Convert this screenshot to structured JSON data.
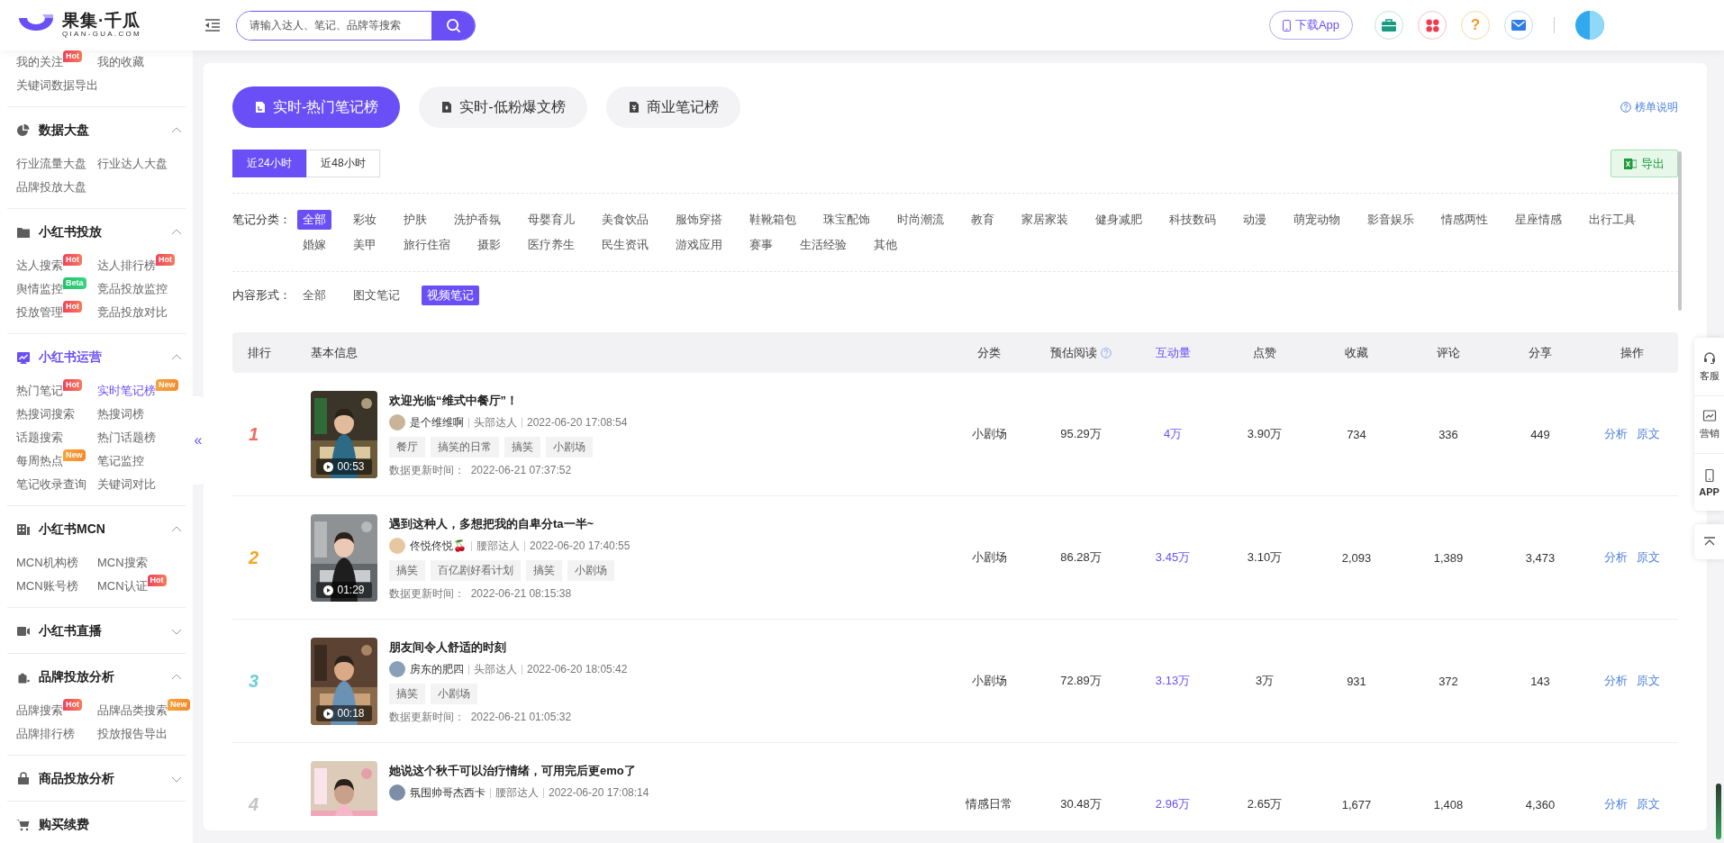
{
  "logo": {
    "title": "果集·千瓜",
    "subtitle": "QIAN-GUA.COM"
  },
  "top_bar": {
    "search": {
      "placeholder": "请输入达人、笔记、品牌等搜索"
    },
    "download_button": "下载App",
    "help_button": "?"
  },
  "sidebar": {
    "sections": [
      {
        "items": [
          {
            "label": "我的关注",
            "selected": false,
            "badge": {
              "kind": "hot",
              "label": "Hot"
            }
          },
          {
            "label": "我的收藏",
            "selected": false
          },
          {
            "label": "关键词数据导出",
            "selected": false
          }
        ]
      },
      {
        "kind": "group",
        "title": "数据大盘",
        "active": false,
        "expanded": true,
        "items": [
          {
            "label": "行业流量大盘",
            "selected": false
          },
          {
            "label": "行业达人大盘",
            "selected": false
          },
          {
            "label": "品牌投放大盘",
            "selected": false
          }
        ]
      },
      {
        "kind": "group",
        "title": "小红书投放",
        "active": false,
        "expanded": true,
        "items": [
          {
            "label": "达人搜索",
            "selected": false,
            "badge": {
              "kind": "hot",
              "label": "Hot"
            }
          },
          {
            "label": "达人排行榜",
            "selected": false,
            "badge": {
              "kind": "hot",
              "label": "Hot"
            }
          },
          {
            "label": "舆情监控",
            "selected": false,
            "badge": {
              "kind": "beta",
              "label": "Beta"
            }
          },
          {
            "label": "竞品投放监控",
            "selected": false
          },
          {
            "label": "投放管理",
            "selected": false,
            "badge": {
              "kind": "hot",
              "label": "Hot"
            }
          },
          {
            "label": "竞品投放对比",
            "selected": false
          }
        ]
      },
      {
        "kind": "group",
        "title": "小红书运营",
        "active": true,
        "expanded": true,
        "items": [
          {
            "label": "热门笔记",
            "selected": false,
            "badge": {
              "kind": "hot",
              "label": "Hot"
            }
          },
          {
            "label": "实时笔记榜",
            "selected": true,
            "badge": {
              "kind": "new",
              "label": "New"
            }
          },
          {
            "label": "热搜词搜索",
            "selected": false
          },
          {
            "label": "热搜词榜",
            "selected": false
          },
          {
            "label": "话题搜索",
            "selected": false
          },
          {
            "label": "热门话题榜",
            "selected": false
          },
          {
            "label": "每周热点",
            "selected": false,
            "badge": {
              "kind": "new",
              "label": "New"
            }
          },
          {
            "label": "笔记监控",
            "selected": false
          },
          {
            "label": "笔记收录查询",
            "selected": false
          },
          {
            "label": "关键词对比",
            "selected": false
          }
        ]
      },
      {
        "kind": "group",
        "title": "小红书MCN",
        "active": false,
        "expanded": true,
        "items": [
          {
            "label": "MCN机构榜",
            "selected": false
          },
          {
            "label": "MCN搜索",
            "selected": false
          },
          {
            "label": "MCN账号榜",
            "selected": false
          },
          {
            "label": "MCN认证",
            "selected": false,
            "badge": {
              "kind": "hot",
              "label": "Hot"
            }
          }
        ]
      },
      {
        "kind": "group",
        "title": "小红书直播",
        "active": false,
        "expanded": false
      },
      {
        "kind": "group",
        "title": "品牌投放分析",
        "active": false,
        "expanded": true,
        "items": [
          {
            "label": "品牌搜索",
            "selected": false,
            "badge": {
              "kind": "hot",
              "label": "Hot"
            }
          },
          {
            "label": "品牌品类搜索",
            "selected": false,
            "badge": {
              "kind": "new",
              "label": "New"
            }
          },
          {
            "label": "品牌排行榜",
            "selected": false
          },
          {
            "label": "投放报告导出",
            "selected": false
          }
        ]
      },
      {
        "kind": "group",
        "title": "商品投放分析",
        "active": false,
        "expanded": false
      },
      {
        "kind": "link",
        "title": "购买续费",
        "active": false
      }
    ],
    "collapse_handle": "«"
  },
  "tabs": [
    {
      "label": "实时-热门笔记榜",
      "selected": true
    },
    {
      "label": "实时-低粉爆文榜",
      "selected": false
    },
    {
      "label": "商业笔记榜",
      "selected": false
    }
  ],
  "help_link": "榜单说明",
  "time_ranges": [
    {
      "label": "近24小时",
      "selected": true
    },
    {
      "label": "近48小时",
      "selected": false
    }
  ],
  "export_button": "导出",
  "category_filter": {
    "label": "笔记分类：",
    "options": [
      {
        "label": "全部",
        "selected": true
      },
      {
        "label": "彩妆",
        "selected": false
      },
      {
        "label": "护肤",
        "selected": false
      },
      {
        "label": "洗护香氛",
        "selected": false
      },
      {
        "label": "母婴育儿",
        "selected": false
      },
      {
        "label": "美食饮品",
        "selected": false
      },
      {
        "label": "服饰穿搭",
        "selected": false
      },
      {
        "label": "鞋靴箱包",
        "selected": false
      },
      {
        "label": "珠宝配饰",
        "selected": false
      },
      {
        "label": "时尚潮流",
        "selected": false
      },
      {
        "label": "教育",
        "selected": false
      },
      {
        "label": "家居家装",
        "selected": false
      },
      {
        "label": "健身减肥",
        "selected": false
      },
      {
        "label": "科技数码",
        "selected": false
      },
      {
        "label": "动漫",
        "selected": false
      },
      {
        "label": "萌宠动物",
        "selected": false
      },
      {
        "label": "影音娱乐",
        "selected": false
      },
      {
        "label": "情感两性",
        "selected": false
      },
      {
        "label": "星座情感",
        "selected": false
      },
      {
        "label": "出行工具",
        "selected": false
      },
      {
        "label": "婚嫁",
        "selected": false
      },
      {
        "label": "美甲",
        "selected": false
      },
      {
        "label": "旅行住宿",
        "selected": false
      },
      {
        "label": "摄影",
        "selected": false
      },
      {
        "label": "医疗养生",
        "selected": false
      },
      {
        "label": "民生资讯",
        "selected": false
      },
      {
        "label": "游戏应用",
        "selected": false
      },
      {
        "label": "赛事",
        "selected": false
      },
      {
        "label": "生活经验",
        "selected": false
      },
      {
        "label": "其他",
        "selected": false
      }
    ]
  },
  "format_filter": {
    "label": "内容形式：",
    "options": [
      {
        "label": "全部",
        "selected": false
      },
      {
        "label": "图文笔记",
        "selected": false
      },
      {
        "label": "视频笔记",
        "selected": true
      }
    ]
  },
  "table": {
    "columns": [
      {
        "label": "排行",
        "sorted": false,
        "help": false
      },
      {
        "label": "基本信息",
        "sorted": false,
        "help": false
      },
      {
        "label": "分类",
        "sorted": false,
        "help": false
      },
      {
        "label": "预估阅读",
        "sorted": false,
        "help": true
      },
      {
        "label": "互动量",
        "sorted": true,
        "help": false
      },
      {
        "label": "点赞",
        "sorted": false,
        "help": false
      },
      {
        "label": "收藏",
        "sorted": false,
        "help": false
      },
      {
        "label": "评论",
        "sorted": false,
        "help": false
      },
      {
        "label": "分享",
        "sorted": false,
        "help": false
      },
      {
        "label": "操作",
        "sorted": false,
        "help": false
      }
    ],
    "rows": [
      {
        "rank": "1",
        "color": "#ef6a5b",
        "duration": "00:53",
        "title": "欢迎光临“维式中餐厅”！",
        "author": "是个维维啊",
        "tier": "头部达人",
        "published": "2022-06-20 17:08:54",
        "tags": [
          "餐厅",
          "搞笑的日常",
          "搞笑",
          "小剧场"
        ],
        "updated_label": "数据更新时间：",
        "updated": "2022-06-21 07:37:52",
        "stats": [
          "小剧场",
          "95.29万",
          "4万",
          "3.90万",
          "734",
          "336",
          "449"
        ],
        "actions": [
          "分析",
          "原文"
        ]
      },
      {
        "rank": "2",
        "color": "#f5a623",
        "duration": "01:29",
        "title": "遇到这种人，多想把我的自卑分ta一半~",
        "author": "佟悦佟悦🍒",
        "tier": "腰部达人",
        "published": "2022-06-20 17:40:55",
        "tags": [
          "搞笑",
          "百亿剧好看计划",
          "搞笑",
          "小剧场"
        ],
        "updated_label": "数据更新时间：",
        "updated": "2022-06-21 08:15:38",
        "stats": [
          "小剧场",
          "86.28万",
          "3.45万",
          "3.10万",
          "2,093",
          "1,389",
          "3,473"
        ],
        "actions": [
          "分析",
          "原文"
        ]
      },
      {
        "rank": "3",
        "color": "#71cfd8",
        "duration": "00:18",
        "title": "朋友间令人舒适的时刻",
        "author": "房东的肥四",
        "tier": "头部达人",
        "published": "2022-06-20 18:05:42",
        "tags": [
          "搞笑",
          "小剧场"
        ],
        "updated_label": "数据更新时间：",
        "updated": "2022-06-21 01:05:32",
        "stats": [
          "小剧场",
          "72.89万",
          "3.13万",
          "3万",
          "931",
          "372",
          "143"
        ],
        "actions": [
          "分析",
          "原文"
        ]
      },
      {
        "rank": "4",
        "color": "#c4c4c4",
        "title": "她说这个秋千可以治疗情绪，可用完后更emo了",
        "author": "氛围帅哥杰西卡",
        "tier": "腰部达人",
        "published": "2022-06-20 17:08:14",
        "stats": [
          "情感日常",
          "30.48万",
          "2.96万",
          "2.65万",
          "1,677",
          "1,408",
          "4,360"
        ],
        "actions": [
          "分析",
          "原文"
        ]
      }
    ]
  },
  "float_panel": {
    "items": [
      "客服",
      "营销",
      "APP"
    ]
  }
}
